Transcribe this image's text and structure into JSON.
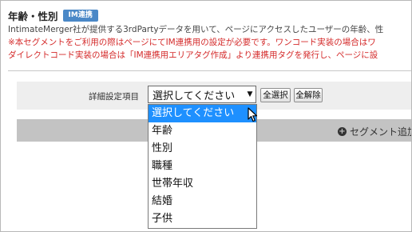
{
  "section": {
    "title": "年齢・性別",
    "badge": "IM連携",
    "description": "IntimateMerger社が提供する3rdPartyデータを用いて、ページにアクセスしたユーザーの年齢、性",
    "warning_line1": "※本セグメントをご利用の際はページにてIM連携用の設定が必要です。ワンコード実装の場合はワ",
    "warning_line2": "ダイレクトコード実装の場合は「IM連携用エリアタグ作成」より連携用タグを発行し、ページに設"
  },
  "filter": {
    "label": "詳細設定項目",
    "selected": "選択してください",
    "select_all_label": "全選択",
    "clear_all_label": "全解除"
  },
  "dropdown_options": [
    "選択してください",
    "年齢",
    "性別",
    "職種",
    "世帯年収",
    "結婚",
    "子供"
  ],
  "add_segment_label": "セグメント追加",
  "colors": {
    "badge": "#4a88c7",
    "warning_text": "#d42a2a",
    "option_highlight": "#1e90ff",
    "add_bar": "#c3c3c3"
  }
}
